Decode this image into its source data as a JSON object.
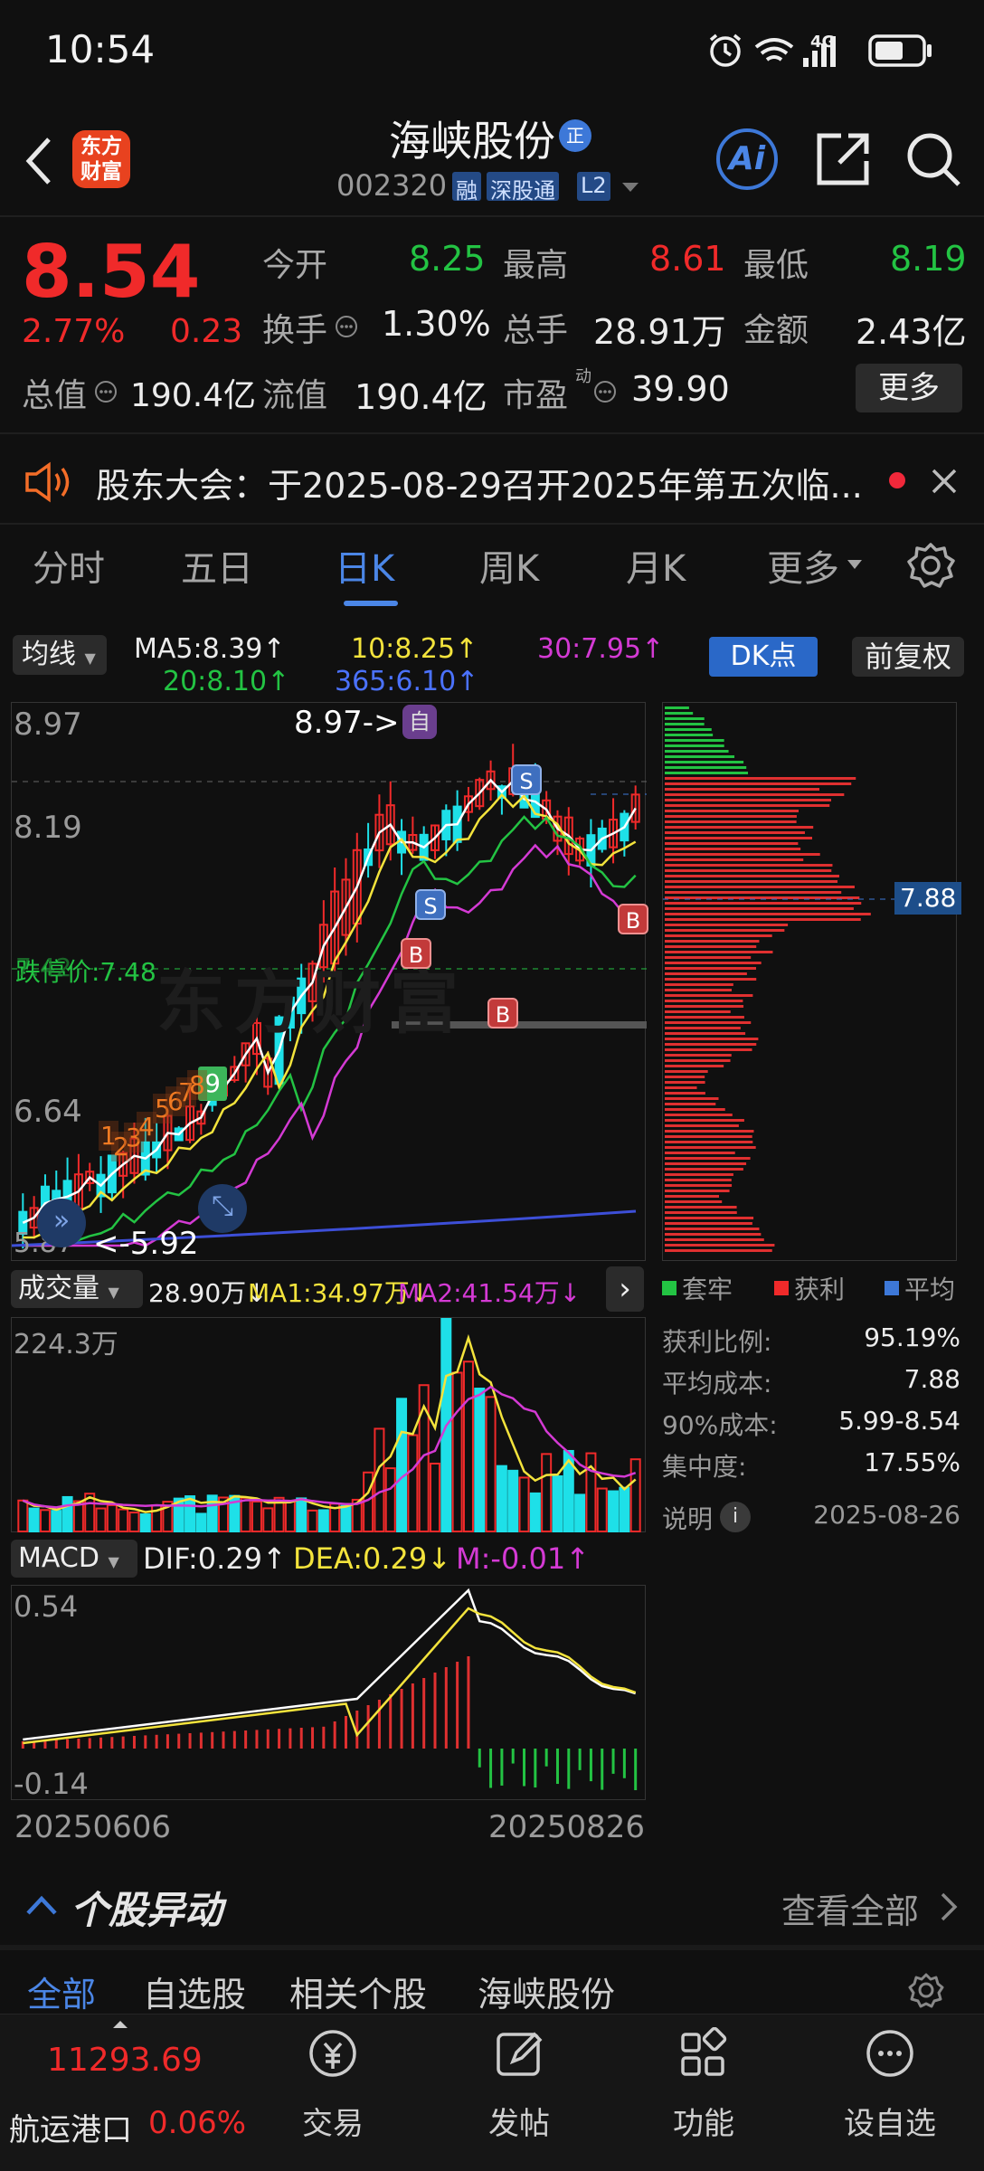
{
  "status": {
    "time": "10:54",
    "network": "4G"
  },
  "header": {
    "logo_line1": "东方",
    "logo_line2": "财富",
    "stock_name": "海峡股份",
    "stock_code": "002320",
    "badges": [
      "融",
      "深股通",
      "L2"
    ],
    "name_badge": "正",
    "ai_label": "Ai"
  },
  "quote": {
    "price": "8.54",
    "change_pct": "2.77%",
    "change_amt": "0.23",
    "total_value_label": "总值",
    "total_value": "190.4亿",
    "open_label": "今开",
    "open": "8.25",
    "high_label": "最高",
    "high": "8.61",
    "low_label": "最低",
    "low": "8.19",
    "turnover_label": "换手",
    "turnover": "1.30%",
    "volume_label": "总手",
    "volume": "28.91万",
    "amount_label": "金额",
    "amount": "2.43亿",
    "float_label": "流值",
    "float_value": "190.4亿",
    "pe_label": "市盈",
    "pe_sup": "动",
    "pe": "39.90",
    "more_label": "更多"
  },
  "notice": {
    "text": "股东大会：于2025-08-29召开2025年第五次临..."
  },
  "tabs": [
    "分时",
    "五日",
    "日K",
    "周K",
    "月K",
    "更多"
  ],
  "active_tab": "日K",
  "ma_legend": {
    "select": "均线",
    "ma5": "MA5:8.39↑",
    "ma10": "10:8.25↑",
    "ma30": "30:7.95↑",
    "ma20": "20:8.10↑",
    "ma365": "365:6.10↑",
    "dk": "DK点",
    "fq": "前复权"
  },
  "kchart": {
    "y_top": "8.97",
    "y_mid": "8.19",
    "y_low": "6.64",
    "y_bottom": "5.87",
    "high_marker": "8.97->",
    "low_marker": "<-5.92",
    "stop_line": "跌停价:7.48",
    "stop_overlap": "7.42",
    "zi_marker": "自",
    "nine_marker": "9",
    "seq_labels": [
      "1",
      "2",
      "3",
      "4",
      "5",
      "6",
      "7",
      "8"
    ],
    "signals": [
      "S",
      "S",
      "B",
      "B",
      "B"
    ],
    "watermark": "东方财富"
  },
  "chip_dist": {
    "cost_marker": "7.88",
    "legend": [
      "套牢",
      "获利",
      "平均"
    ],
    "rows": [
      {
        "label": "获利比例:",
        "value": "95.19%"
      },
      {
        "label": "平均成本:",
        "value": "7.88"
      },
      {
        "label": "90%成本:",
        "value": "5.99-8.54"
      },
      {
        "label": "集中度:",
        "value": "17.55%"
      }
    ],
    "note_label": "说明",
    "date": "2025-08-26"
  },
  "volume": {
    "select": "成交量",
    "vol": "28.90万↓",
    "ma1": "MA1:34.97万↓",
    "ma2": "MA2:41.54万↓",
    "y_top": "224.3万"
  },
  "macd": {
    "select": "MACD",
    "dif": "DIF:0.29↑",
    "dea": "DEA:0.29↓",
    "m": "M:-0.01↑",
    "y_top": "0.54",
    "y_bottom": "-0.14"
  },
  "dates": {
    "start": "20250606",
    "end": "20250826"
  },
  "movement": {
    "title": "个股异动",
    "see_all": "查看全部"
  },
  "sub_tabs": [
    "全部",
    "自选股",
    "相关个股",
    "海峡股份"
  ],
  "bottom": {
    "index_value": "11293.69",
    "index_name": "航运港口",
    "index_pct": "0.06%",
    "nav": [
      "交易",
      "发帖",
      "功能",
      "设自选"
    ]
  }
}
